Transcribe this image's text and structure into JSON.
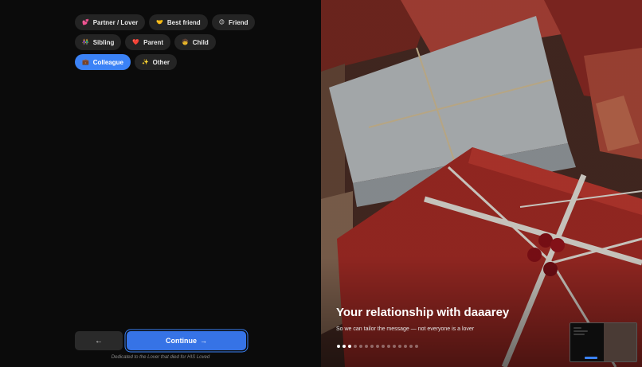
{
  "relationships": [
    {
      "emoji": "💕",
      "label": "Partner / Lover",
      "selected": false
    },
    {
      "emoji": "🤝",
      "label": "Best friend",
      "selected": false
    },
    {
      "emoji": "😊",
      "label": "Friend",
      "selected": false
    },
    {
      "emoji": "👫",
      "label": "Sibling",
      "selected": false
    },
    {
      "emoji": "❤️",
      "label": "Parent",
      "selected": false
    },
    {
      "emoji": "🧒",
      "label": "Child",
      "selected": false
    },
    {
      "emoji": "💼",
      "label": "Colleague",
      "selected": true
    },
    {
      "emoji": "✨",
      "label": "Other",
      "selected": false
    }
  ],
  "nav": {
    "back_label": "←",
    "continue_label": "Continue",
    "continue_arrow": "→"
  },
  "dedication": "Dedicated to the Lover that died for HIS Loved",
  "hero": {
    "title": "Your relationship with daaarey",
    "subtitle": "So we can tailor the message — not everyone is a lover"
  },
  "progress": {
    "total_steps": 15,
    "current_step": 3
  },
  "colors": {
    "accent": "#3b82f6",
    "background": "#0b0b0b",
    "chip": "#242424"
  }
}
